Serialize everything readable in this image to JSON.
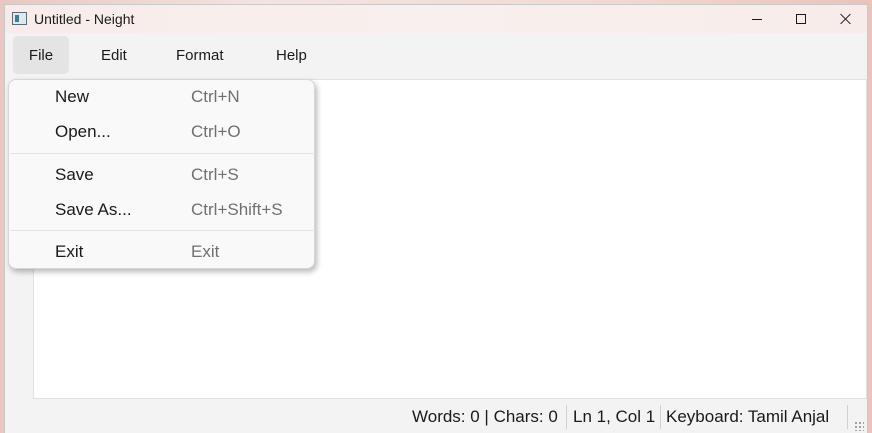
{
  "window": {
    "title": "Untitled - Neight"
  },
  "menubar": {
    "items": [
      {
        "label": "File"
      },
      {
        "label": "Edit"
      },
      {
        "label": "Format"
      },
      {
        "label": "Help"
      }
    ],
    "active": "File"
  },
  "file_menu": {
    "items": [
      {
        "label": "New",
        "shortcut": "Ctrl+N"
      },
      {
        "label": "Open...",
        "shortcut": "Ctrl+O"
      },
      {
        "label": "Save",
        "shortcut": "Ctrl+S"
      },
      {
        "label": "Save As...",
        "shortcut": "Ctrl+Shift+S"
      },
      {
        "label": "Exit",
        "shortcut": "Exit"
      }
    ]
  },
  "editor": {
    "content": ""
  },
  "statusbar": {
    "counts": "Words: 0 | Chars: 0",
    "position": "Ln 1, Col 1",
    "keyboard": "Keyboard: Tamil Anjal"
  },
  "icons": {
    "app": "notepad-window-icon",
    "minimize": "minimize-icon",
    "maximize": "maximize-icon",
    "close": "close-icon",
    "resize": "resize-grip-icon"
  },
  "colors": {
    "menu_background": "#f9f9f9",
    "shortcut_text": "#707070",
    "active_menu_highlight": "#e4e4e4"
  }
}
